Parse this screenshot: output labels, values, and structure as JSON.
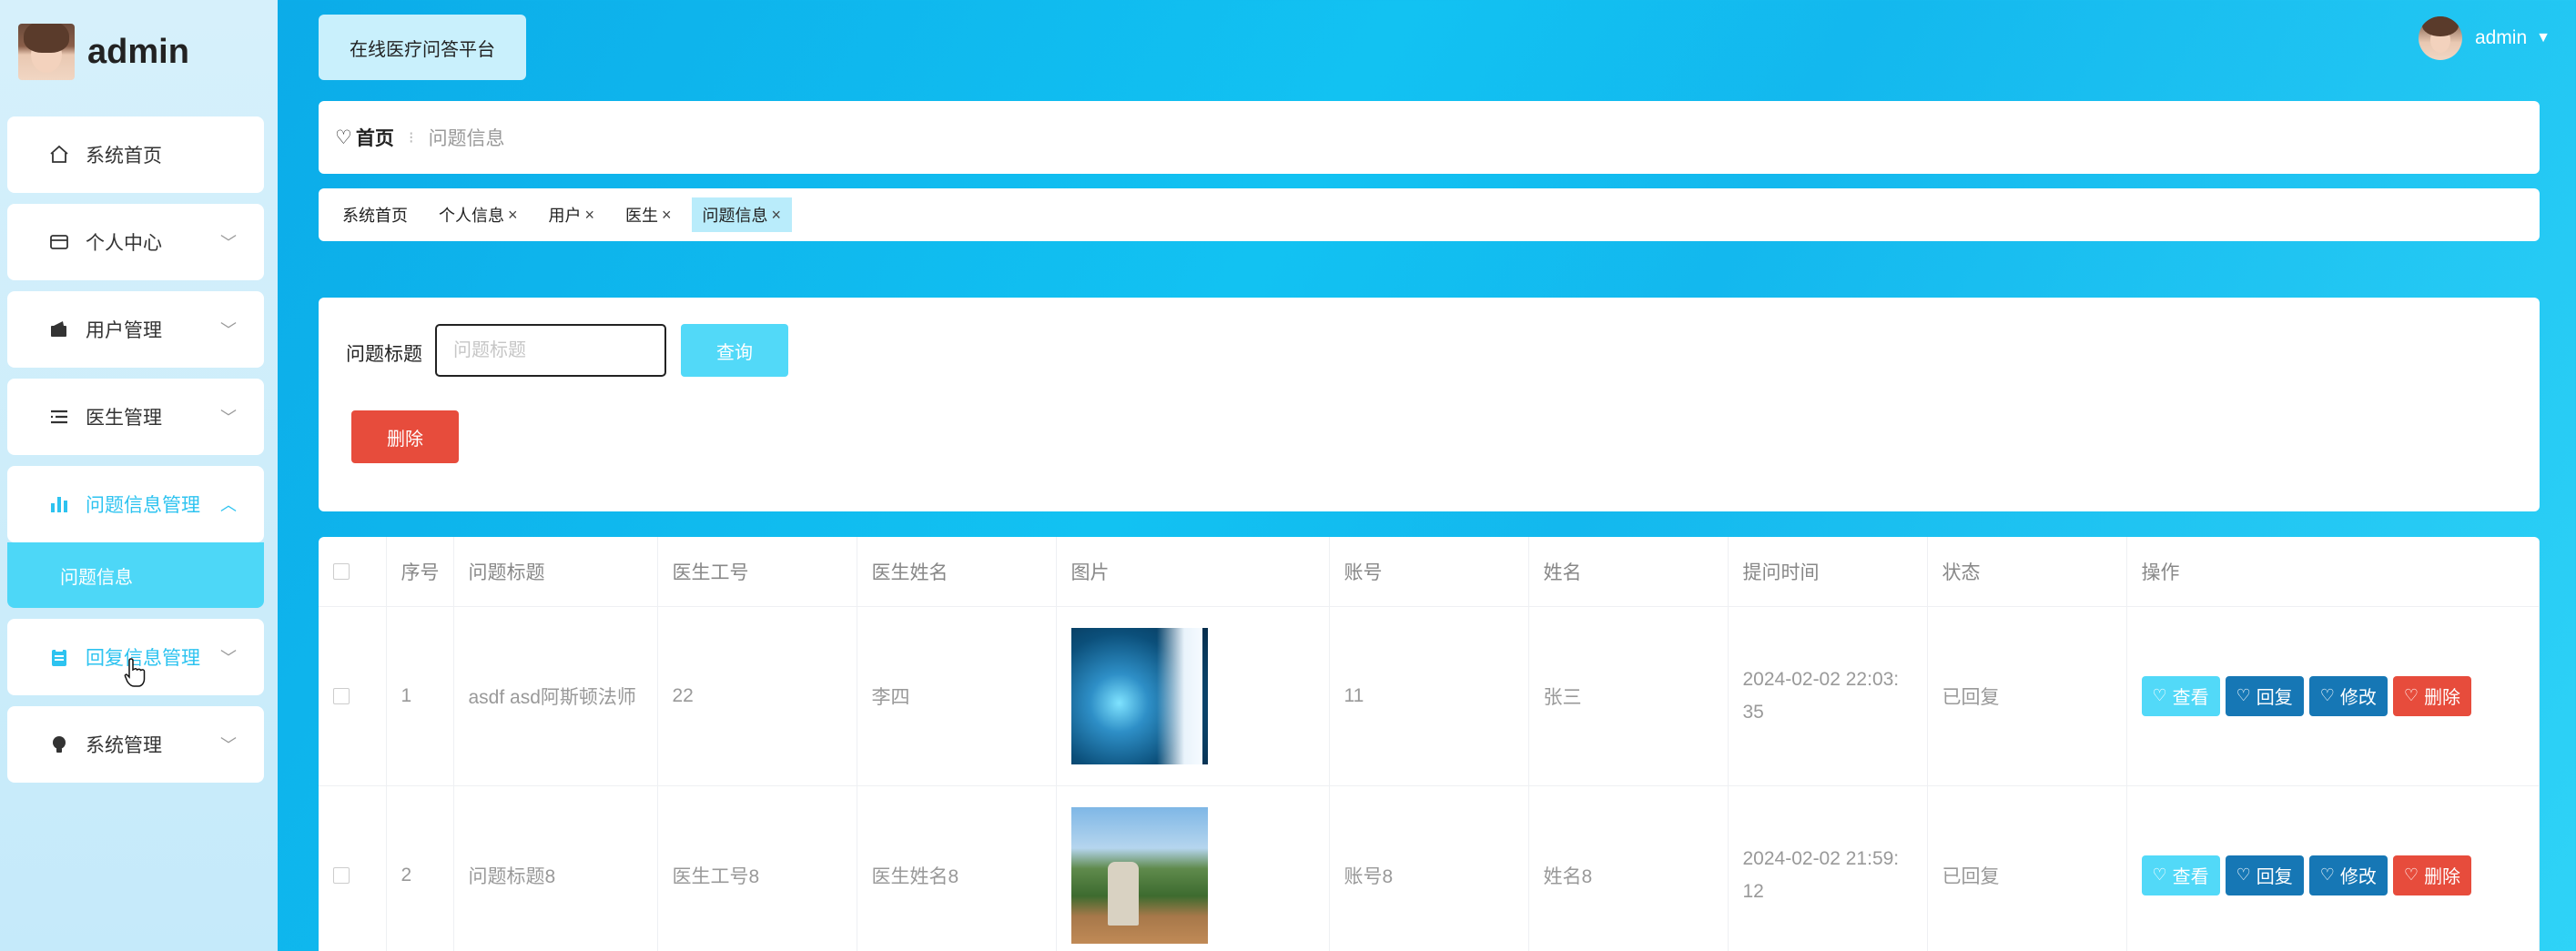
{
  "sidebar": {
    "brand": "admin",
    "items": [
      {
        "label": "系统首页",
        "icon": "home-icon",
        "has_arrow": false
      },
      {
        "label": "个人中心",
        "icon": "card-icon",
        "has_arrow": true
      },
      {
        "label": "用户管理",
        "icon": "wallet-icon",
        "has_arrow": true
      },
      {
        "label": "医生管理",
        "icon": "list-icon",
        "has_arrow": true
      },
      {
        "label": "问题信息管理",
        "icon": "bar-chart-icon",
        "has_arrow": true,
        "expanded": true
      },
      {
        "label": "回复信息管理",
        "icon": "clipboard-icon",
        "has_arrow": true
      },
      {
        "label": "系统管理",
        "icon": "lightbulb-icon",
        "has_arrow": true
      }
    ],
    "submenu": [
      {
        "label": "问题信息"
      }
    ]
  },
  "header": {
    "site_title": "在线医疗问答平台",
    "username": "admin"
  },
  "breadcrumb": {
    "home": "首页",
    "current": "问题信息"
  },
  "tags": [
    {
      "label": "系统首页",
      "closable": false
    },
    {
      "label": "个人信息",
      "closable": true
    },
    {
      "label": "用户",
      "closable": true
    },
    {
      "label": "医生",
      "closable": true
    },
    {
      "label": "问题信息",
      "closable": true,
      "active": true
    }
  ],
  "search": {
    "label": "问题标题",
    "placeholder": "问题标题",
    "value": "",
    "query_button": "查询",
    "delete_button": "删除"
  },
  "table": {
    "columns": [
      "序号",
      "问题标题",
      "医生工号",
      "医生姓名",
      "图片",
      "账号",
      "姓名",
      "提问时间",
      "状态",
      "操作"
    ],
    "rows": [
      {
        "index": "1",
        "title": "asdf asd阿斯顿法师",
        "doctor_id": "22",
        "doctor_name": "李四",
        "image": "image-thumbnail",
        "account": "11",
        "name": "张三",
        "time_line1": "2024-02-02 22:03:",
        "time_line2": "35",
        "status": "已回复"
      },
      {
        "index": "2",
        "title": "问题标题8",
        "doctor_id": "医生工号8",
        "doctor_name": "医生姓名8",
        "image": "image-thumbnail",
        "account": "账号8",
        "name": "姓名8",
        "time_line1": "2024-02-02 21:59:",
        "time_line2": "12",
        "status": "已回复"
      }
    ],
    "actions": {
      "view": "查看",
      "reply": "回复",
      "edit": "修改",
      "delete": "删除"
    }
  }
}
